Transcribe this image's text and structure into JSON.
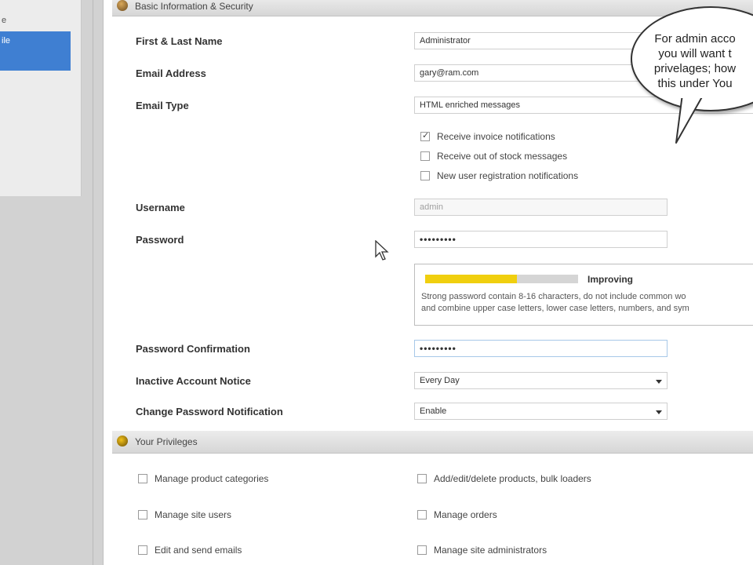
{
  "sidebar": {
    "items": [
      {
        "label": "e"
      },
      {
        "label": "ile"
      }
    ]
  },
  "basic_section": {
    "title": "Basic Information & Security",
    "fields": {
      "name": {
        "label": "First & Last Name",
        "value": "Administrator"
      },
      "email": {
        "label": "Email Address",
        "value": "gary@ram.com"
      },
      "email_type": {
        "label": "Email Type",
        "value": "HTML enriched messages"
      },
      "notifications": [
        {
          "label": "Receive invoice notifications",
          "checked": true
        },
        {
          "label": "Receive out of stock messages",
          "checked": false
        },
        {
          "label": "New user registration notifications",
          "checked": false
        }
      ],
      "username": {
        "label": "Username",
        "value": "admin"
      },
      "password": {
        "label": "Password",
        "value": "•••••••••"
      },
      "password_confirm": {
        "label": "Password Confirmation",
        "value": "•••••••••"
      },
      "inactive_notice": {
        "label": "Inactive Account Notice",
        "value": "Every Day"
      },
      "change_pw_notice": {
        "label": "Change Password Notification",
        "value": "Enable"
      }
    },
    "strength": {
      "label": "Improving",
      "level": 0.6,
      "help_line1": "Strong password contain 8-16 characters, do not include common wo",
      "help_line2": "and combine upper case letters, lower case letters, numbers, and sym",
      "color": "#f0cf0f"
    }
  },
  "privileges_section": {
    "title": "Your Privileges",
    "items": [
      {
        "label": "Manage product categories",
        "checked": false
      },
      {
        "label": "Add/edit/delete products, bulk loaders",
        "checked": false
      },
      {
        "label": "Manage site users",
        "checked": false
      },
      {
        "label": "Manage orders",
        "checked": false
      },
      {
        "label": "Edit and send emails",
        "checked": false
      },
      {
        "label": "Manage site administrators",
        "checked": false
      }
    ]
  },
  "callout": {
    "text": "For admin acco\nyou will want t\nprivelages; how\nthis under You"
  },
  "colors": {
    "selected_nav": "#3f7fd2",
    "section_header": "#dcdcdc"
  }
}
